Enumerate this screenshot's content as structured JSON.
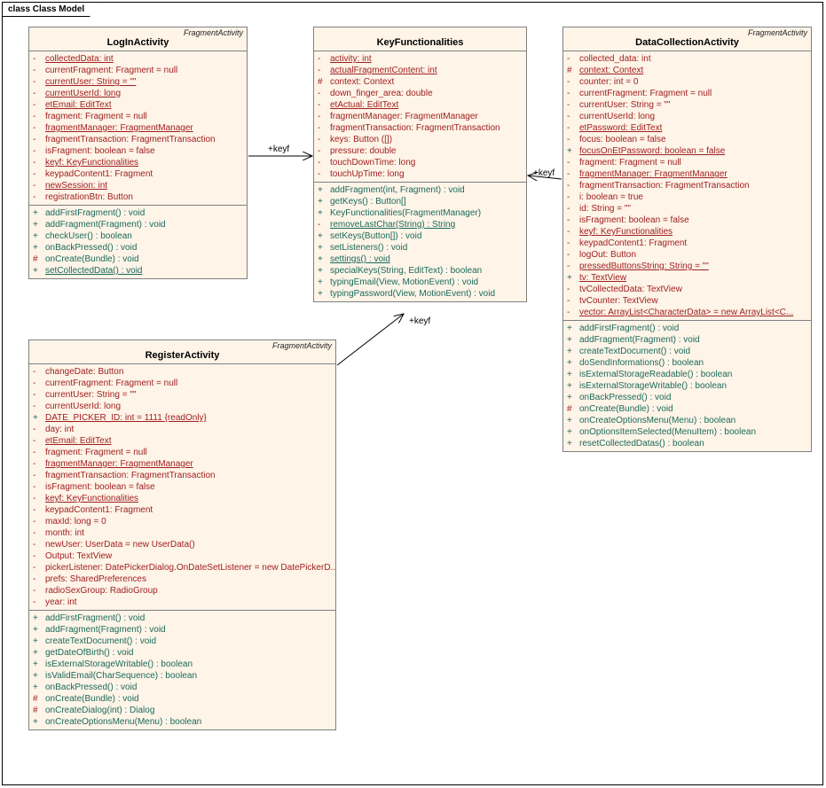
{
  "frame_title": "class Class Model",
  "classes": {
    "login": {
      "stereotype": "FragmentActivity",
      "name": "LogInActivity",
      "attrs": [
        {
          "v": "-",
          "t": "collectedData:  int",
          "u": true
        },
        {
          "v": "-",
          "t": "currentFragment:  Fragment = null"
        },
        {
          "v": "-",
          "t": "currentUser:  String = \"\"",
          "u": true
        },
        {
          "v": "-",
          "t": "currentUserId:  long",
          "u": true
        },
        {
          "v": "-",
          "t": "etEmail:  EditText",
          "u": true
        },
        {
          "v": "-",
          "t": "fragment:  Fragment = null"
        },
        {
          "v": "-",
          "t": "fragmentManager:  FragmentManager",
          "u": true
        },
        {
          "v": "-",
          "t": "fragmentTransaction:  FragmentTransaction"
        },
        {
          "v": "-",
          "t": "isFragment:  boolean = false"
        },
        {
          "v": "-",
          "t": "keyf:  KeyFunctionalities",
          "u": true
        },
        {
          "v": "-",
          "t": "keypadContent1:  Fragment"
        },
        {
          "v": "-",
          "t": "newSession:  int",
          "u": true
        },
        {
          "v": "-",
          "t": "registrationBtn:  Button"
        }
      ],
      "ops": [
        {
          "v": "+",
          "t": "addFirstFragment() : void"
        },
        {
          "v": "+",
          "t": "addFragment(Fragment) : void"
        },
        {
          "v": "+",
          "t": "checkUser() : boolean"
        },
        {
          "v": "+",
          "t": "onBackPressed() : void"
        },
        {
          "v": "#",
          "t": "onCreate(Bundle) : void"
        },
        {
          "v": "+",
          "t": "setCollectedData() : void",
          "u": true
        }
      ]
    },
    "keyf": {
      "name": "KeyFunctionalities",
      "attrs": [
        {
          "v": "-",
          "t": "activity:  int",
          "u": true
        },
        {
          "v": "-",
          "t": "actualFragmentContent:  int",
          "u": true
        },
        {
          "v": "#",
          "t": "context:  Context"
        },
        {
          "v": "-",
          "t": "down_finger_area:  double"
        },
        {
          "v": "-",
          "t": "etActual:  EditText",
          "u": true
        },
        {
          "v": "-",
          "t": "fragmentManager:  FragmentManager"
        },
        {
          "v": "-",
          "t": "fragmentTransaction:  FragmentTransaction"
        },
        {
          "v": "-",
          "t": "keys:  Button ([])"
        },
        {
          "v": "-",
          "t": "pressure:  double"
        },
        {
          "v": "-",
          "t": "touchDownTime:  long"
        },
        {
          "v": "-",
          "t": "touchUpTime:  long"
        }
      ],
      "ops": [
        {
          "v": "+",
          "t": "addFragment(int, Fragment) : void"
        },
        {
          "v": "+",
          "t": "getKeys() : Button[]"
        },
        {
          "v": "+",
          "t": "KeyFunctionalities(FragmentManager)"
        },
        {
          "v": "-",
          "t": "removeLastChar(String) : String",
          "u": true
        },
        {
          "v": "+",
          "t": "setKeys(Button[]) : void"
        },
        {
          "v": "+",
          "t": "setListeners() : void"
        },
        {
          "v": "+",
          "t": "settings() : void",
          "u": true
        },
        {
          "v": "+",
          "t": "specialKeys(String, EditText) : boolean"
        },
        {
          "v": "+",
          "t": "typingEmail(View, MotionEvent) : void"
        },
        {
          "v": "+",
          "t": "typingPassword(View, MotionEvent) : void"
        }
      ]
    },
    "register": {
      "stereotype": "FragmentActivity",
      "name": "RegisterActivity",
      "attrs": [
        {
          "v": "-",
          "t": "changeDate:  Button"
        },
        {
          "v": "-",
          "t": "currentFragment:  Fragment = null"
        },
        {
          "v": "-",
          "t": "currentUser:  String = \"\""
        },
        {
          "v": "-",
          "t": "currentUserId:  long"
        },
        {
          "v": "+",
          "t": "DATE_PICKER_ID:  int = 1111 {readOnly}",
          "u": true
        },
        {
          "v": "-",
          "t": "day:  int"
        },
        {
          "v": "-",
          "t": "etEmail:  EditText",
          "u": true
        },
        {
          "v": "-",
          "t": "fragment:  Fragment = null"
        },
        {
          "v": "-",
          "t": "fragmentManager:  FragmentManager",
          "u": true
        },
        {
          "v": "-",
          "t": "fragmentTransaction:  FragmentTransaction"
        },
        {
          "v": "-",
          "t": "isFragment:  boolean = false"
        },
        {
          "v": "-",
          "t": "keyf:  KeyFunctionalities",
          "u": true
        },
        {
          "v": "-",
          "t": "keypadContent1:  Fragment"
        },
        {
          "v": "-",
          "t": "maxId:  long = 0"
        },
        {
          "v": "-",
          "t": "month:  int"
        },
        {
          "v": "-",
          "t": "newUser:  UserData = new UserData()"
        },
        {
          "v": "-",
          "t": "Output:  TextView"
        },
        {
          "v": "-",
          "t": "pickerListener:  DatePickerDialog.OnDateSetListener = new DatePickerD..."
        },
        {
          "v": "-",
          "t": "prefs:  SharedPreferences"
        },
        {
          "v": "-",
          "t": "radioSexGroup:  RadioGroup"
        },
        {
          "v": "-",
          "t": "year:  int"
        }
      ],
      "ops": [
        {
          "v": "+",
          "t": "addFirstFragment() : void"
        },
        {
          "v": "+",
          "t": "addFragment(Fragment) : void"
        },
        {
          "v": "+",
          "t": "createTextDocument() : void"
        },
        {
          "v": "+",
          "t": "getDateOfBirth() : void"
        },
        {
          "v": "+",
          "t": "isExternalStorageWritable() : boolean"
        },
        {
          "v": "+",
          "t": "isValidEmail(CharSequence) : boolean"
        },
        {
          "v": "+",
          "t": "onBackPressed() : void"
        },
        {
          "v": "#",
          "t": "onCreate(Bundle) : void"
        },
        {
          "v": "#",
          "t": "onCreateDialog(int) : Dialog"
        },
        {
          "v": "+",
          "t": "onCreateOptionsMenu(Menu) : boolean"
        }
      ]
    },
    "data": {
      "stereotype": "FragmentActivity",
      "name": "DataCollectionActivity",
      "attrs": [
        {
          "v": "-",
          "t": "collected_data:  int"
        },
        {
          "v": "#",
          "t": "context:  Context",
          "u": true
        },
        {
          "v": "-",
          "t": "counter:  int = 0"
        },
        {
          "v": "-",
          "t": "currentFragment:  Fragment = null"
        },
        {
          "v": "-",
          "t": "currentUser:  String = \"\""
        },
        {
          "v": "-",
          "t": "currentUserId:  long"
        },
        {
          "v": "-",
          "t": "etPassword:  EditText",
          "u": true
        },
        {
          "v": "-",
          "t": "focus:  boolean = false"
        },
        {
          "v": "+",
          "t": "focusOnEtPassword:  boolean = false",
          "u": true
        },
        {
          "v": "-",
          "t": "fragment:  Fragment = null"
        },
        {
          "v": "-",
          "t": "fragmentManager:  FragmentManager",
          "u": true
        },
        {
          "v": "-",
          "t": "fragmentTransaction:  FragmentTransaction"
        },
        {
          "v": "-",
          "t": "i:  boolean = true"
        },
        {
          "v": "-",
          "t": "id:  String = \"\""
        },
        {
          "v": "-",
          "t": "isFragment:  boolean = false"
        },
        {
          "v": "-",
          "t": "keyf:  KeyFunctionalities",
          "u": true
        },
        {
          "v": "-",
          "t": "keypadContent1:  Fragment"
        },
        {
          "v": "-",
          "t": "logOut:  Button"
        },
        {
          "v": "-",
          "t": "pressedButtonsString:  String = \"\"",
          "u": true
        },
        {
          "v": "+",
          "t": "tv:  TextView",
          "u": true
        },
        {
          "v": "-",
          "t": "tvCollectedData:  TextView"
        },
        {
          "v": "-",
          "t": "tvCounter:  TextView"
        },
        {
          "v": "-",
          "t": "vector:  ArrayList<CharacterData> = new ArrayList<C...",
          "u": true
        }
      ],
      "ops": [
        {
          "v": "+",
          "t": "addFirstFragment() : void"
        },
        {
          "v": "+",
          "t": "addFragment(Fragment) : void"
        },
        {
          "v": "+",
          "t": "createTextDocument() : void"
        },
        {
          "v": "+",
          "t": "doSendInformations() : boolean"
        },
        {
          "v": "+",
          "t": "isExternalStorageReadable() : boolean"
        },
        {
          "v": "+",
          "t": "isExternalStorageWritable() : boolean"
        },
        {
          "v": "+",
          "t": "onBackPressed() : void"
        },
        {
          "v": "#",
          "t": "onCreate(Bundle) : void"
        },
        {
          "v": "+",
          "t": "onCreateOptionsMenu(Menu) : boolean"
        },
        {
          "v": "+",
          "t": "onOptionsItemSelected(MenuItem) : boolean"
        },
        {
          "v": "+",
          "t": "resetCollectedDatas() : boolean"
        }
      ]
    }
  },
  "roles": {
    "r1": "+keyf",
    "r2": "+keyf",
    "r3": "+keyf"
  }
}
